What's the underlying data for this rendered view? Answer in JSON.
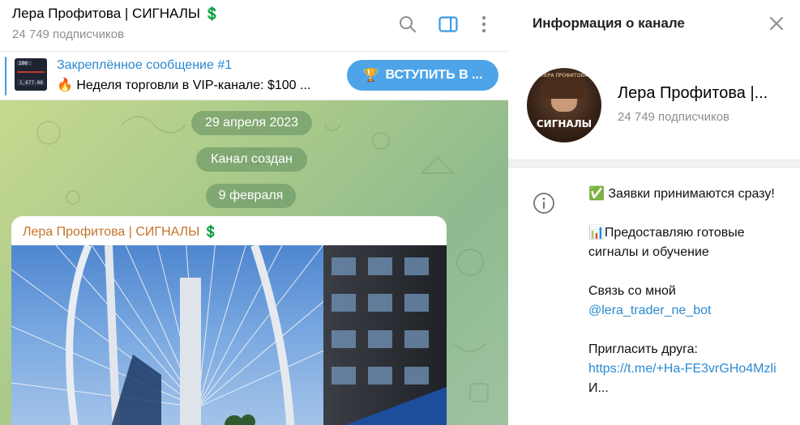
{
  "chat": {
    "title": "Лера Профитова | СИГНАЛЫ",
    "title_emoji": "💲",
    "subscribers": "24 749 подписчиков",
    "header_icons": [
      "search-icon",
      "sidebar-toggle-icon",
      "more-vertical-icon"
    ]
  },
  "pinned": {
    "title": "Закреплённое сообщение #1",
    "text_emoji": "🔥",
    "text": "Неделя торговли в VIP-канале: $100 ...",
    "thumb_lines": [
      "100",
      "1,677.08"
    ],
    "join_emoji": "🏆",
    "join_label": "ВСТУПИТЬ В ..."
  },
  "timeline": {
    "date1": "29 апреля 2023",
    "created": "Канал создан",
    "date2": "9 февраля"
  },
  "message": {
    "author": "Лера Профитова | СИГНАЛЫ",
    "author_emoji": "💲"
  },
  "info": {
    "panel_title": "Информация о канале",
    "name": "Лера Профитова |...",
    "subscribers": "24 749 подписчиков",
    "avatar_text_small": "ЛЕРА ПРОФИТОВА",
    "avatar_text_big": "СИГНАЛЫ",
    "description": {
      "line1_emoji": "✅",
      "line1": "Заявки принимаются сразу!",
      "line2_emoji": "📊",
      "line2": "Предоставляю готовые сигналы и обучение",
      "contact_label": "Связь со мной",
      "contact_link": "@lera_trader_ne_bot",
      "invite_label": "Пригласить друга:",
      "invite_link": "https://t.me/+Ha-FE3vrGHo4Mzli",
      "cut_text": "И..."
    }
  },
  "colors": {
    "accent": "#2a8ad2",
    "join_button": "#4ea4e8",
    "author": "#c4742b"
  }
}
